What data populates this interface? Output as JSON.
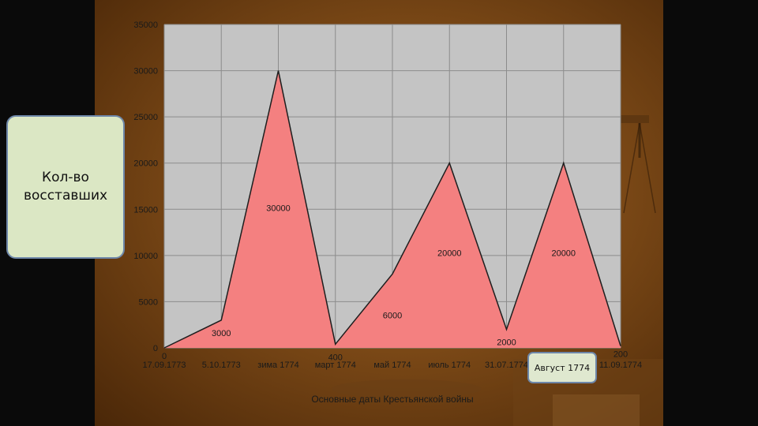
{
  "colors": {
    "plot_background": "#c4c4c4",
    "area_fill": "#f48080",
    "area_outline": "#1e1e1e",
    "slide_background": "#7d4a17",
    "outer_background": "#0a0a0a",
    "label_box_fill": "#dbe7c4",
    "label_box_border": "#6d86a8"
  },
  "y_label_lines": [
    "Кол-во",
    "восставших"
  ],
  "callout": "Август 1774",
  "chart_data": {
    "type": "area",
    "categories": [
      "17.09.1773",
      "5.10.1773",
      "зима 1774",
      "март 1774",
      "май 1774",
      "июль 1774",
      "31.07.1774",
      "Август 1774",
      "11.09.1774"
    ],
    "values": [
      0,
      3000,
      30000,
      400,
      8000,
      20000,
      2000,
      20000,
      200
    ],
    "data_labels": [
      "0",
      "3000",
      "30000",
      "400",
      "6000",
      "20000",
      "2000",
      "20000",
      "200"
    ],
    "xlabel": "Основные даты Крестьянской войны",
    "ylabel": "Кол-во восставших",
    "ylim": [
      0,
      35000
    ],
    "yticks": [
      "0",
      "5000",
      "10000",
      "15000",
      "20000",
      "25000",
      "30000",
      "35000"
    ],
    "grid": true,
    "legend": "none"
  }
}
